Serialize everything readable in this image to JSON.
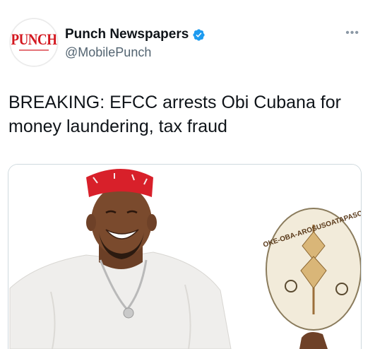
{
  "account": {
    "display_name": "Punch Newspapers",
    "handle": "@MobilePunch",
    "avatar_logo_text": "PUNCH",
    "verified": true
  },
  "menu": {
    "more_icon": "more-horizontal-icon",
    "glyph": "•••"
  },
  "tweet": {
    "text": "BREAKING: EFCC arrests Obi Cubana for money laundering, tax fraud"
  },
  "media": {
    "fan_text": "OKE-OBA-AROSUSOATAPASO"
  },
  "colors": {
    "brand_red": "#d3171f",
    "verified_blue": "#1d9bf0",
    "text_primary": "#0f1419",
    "text_secondary": "#536471"
  }
}
